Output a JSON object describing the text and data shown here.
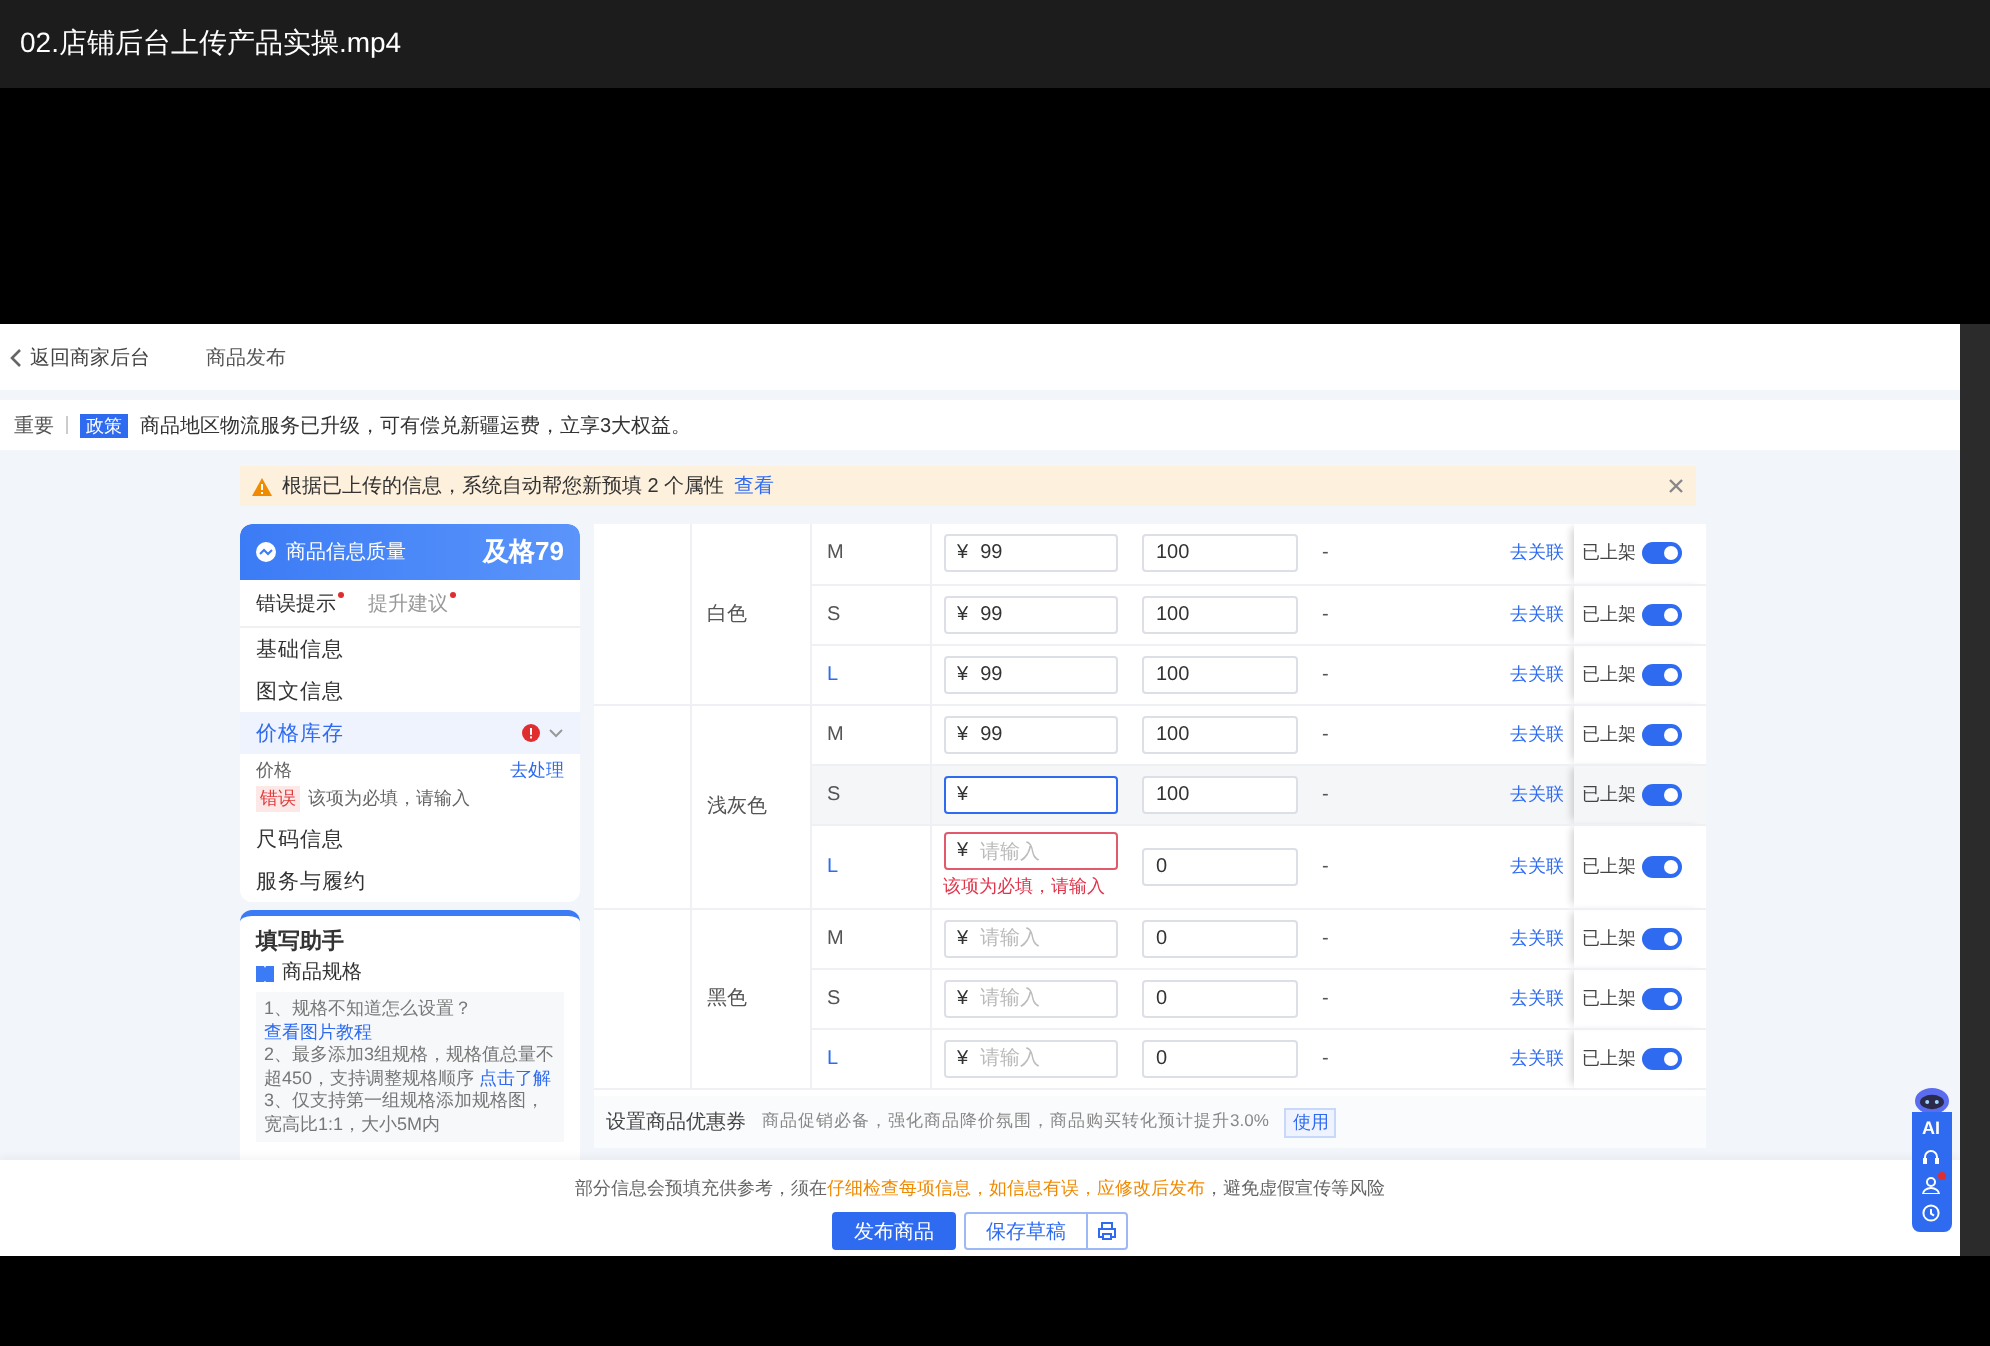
{
  "player": {
    "title": "02.店铺后台上传产品实操.mp4"
  },
  "header": {
    "back_label": "返回商家后台",
    "page_title": "商品发布"
  },
  "notice": {
    "label": "重要",
    "tag": "政策",
    "text": "商品地区物流服务已升级，可有偿兑新疆运费，立享3大权益。"
  },
  "alert": {
    "text": "根据已上传的信息，系统自动帮您新预填 2 个属性",
    "link": "查看"
  },
  "quality": {
    "title": "商品信息质量",
    "score": "及格79"
  },
  "quality_tabs": [
    {
      "label": "错误提示",
      "selected": true,
      "dot": true
    },
    {
      "label": "提升建议",
      "selected": false,
      "dot": true
    }
  ],
  "nav": [
    {
      "label": "基础信息",
      "selected": false,
      "error": false
    },
    {
      "label": "图文信息",
      "selected": false,
      "error": false
    },
    {
      "label": "价格库存",
      "selected": true,
      "error": true,
      "expanded": true,
      "issues": [
        {
          "field": "价格",
          "action": "去处理",
          "tag": "错误",
          "message": "该项为必填，请输入"
        }
      ]
    },
    {
      "label": "尺码信息",
      "selected": false,
      "error": false
    },
    {
      "label": "服务与履约",
      "selected": false,
      "error": false
    }
  ],
  "helper": {
    "title": "填写助手",
    "section": "商品规格",
    "tips": [
      {
        "text": "1、规格不知道怎么设置？",
        "link": "查看图片教程"
      },
      {
        "text": "2、最多添加3组规格，规格值总量不超450，支持调整规格顺序",
        "link": "点击了解"
      },
      {
        "text": "3、仅支持第一组规格添加规格图，宽高比1:1，大小5M内"
      }
    ]
  },
  "sku_table": {
    "groups": [
      {
        "color_name": "白色",
        "rows": [
          {
            "size": "M",
            "linked": false,
            "currency": "¥",
            "price": "99",
            "stock": "100",
            "column_6": "-",
            "link": "去关联",
            "status": "已上架",
            "on": true,
            "focused": false
          },
          {
            "size": "S",
            "linked": false,
            "currency": "¥",
            "price": "99",
            "stock": "100",
            "column_6": "-",
            "link": "去关联",
            "status": "已上架",
            "on": true,
            "focused": false
          },
          {
            "size": "L",
            "linked": true,
            "currency": "¥",
            "price": "99",
            "stock": "100",
            "column_6": "-",
            "link": "去关联",
            "status": "已上架",
            "on": true,
            "focused": false
          }
        ]
      },
      {
        "color_name": "浅灰色",
        "rows": [
          {
            "size": "M",
            "linked": false,
            "currency": "¥",
            "price": "99",
            "stock": "100",
            "column_6": "-",
            "link": "去关联",
            "status": "已上架",
            "on": true,
            "focused": false
          },
          {
            "size": "S",
            "linked": false,
            "currency": "¥",
            "stock": "100",
            "column_6": "-",
            "link": "去关联",
            "status": "已上架",
            "on": true,
            "focused": true
          },
          {
            "size": "L",
            "linked": true,
            "currency": "¥",
            "placeholder": "请输入",
            "error": "该项为必填，请输入",
            "stock": "0",
            "column_6": "-",
            "link": "去关联",
            "status": "已上架",
            "on": true,
            "focused": false
          }
        ]
      },
      {
        "color_name": "黑色",
        "rows": [
          {
            "size": "M",
            "linked": false,
            "currency": "¥",
            "placeholder": "请输入",
            "stock": "0",
            "column_6": "-",
            "link": "去关联",
            "status": "已上架",
            "on": true,
            "focused": false
          },
          {
            "size": "S",
            "linked": false,
            "currency": "¥",
            "placeholder": "请输入",
            "stock": "0",
            "column_6": "-",
            "link": "去关联",
            "status": "已上架",
            "on": true,
            "focused": false
          },
          {
            "size": "L",
            "linked": true,
            "currency": "¥",
            "placeholder": "请输入",
            "stock": "0",
            "column_6": "-",
            "link": "去关联",
            "status": "已上架",
            "on": true,
            "focused": false
          }
        ]
      }
    ]
  },
  "coupon": {
    "label": "设置商品优惠券",
    "text": "商品促销必备，强化商品降价氛围，商品购买转化预计提升3.0%",
    "tag": "使用"
  },
  "footer": {
    "notice": [
      {
        "text": "部分信息会预填充供参考，须在",
        "kind": "plain"
      },
      {
        "text": "仔细检查每项信息，",
        "kind": "warn"
      },
      {
        "text": "如信息有误，",
        "kind": "warn"
      },
      {
        "text": "应修改后发布",
        "kind": "warn"
      },
      {
        "text": "，避免虚假宣传等风险",
        "kind": "plain"
      }
    ],
    "buttons": [
      {
        "label": "发布商品",
        "kind": "primary"
      },
      {
        "label": "保存草稿",
        "kind": "secondary"
      }
    ]
  },
  "assistant": {
    "label": "AI",
    "badge": true
  }
}
